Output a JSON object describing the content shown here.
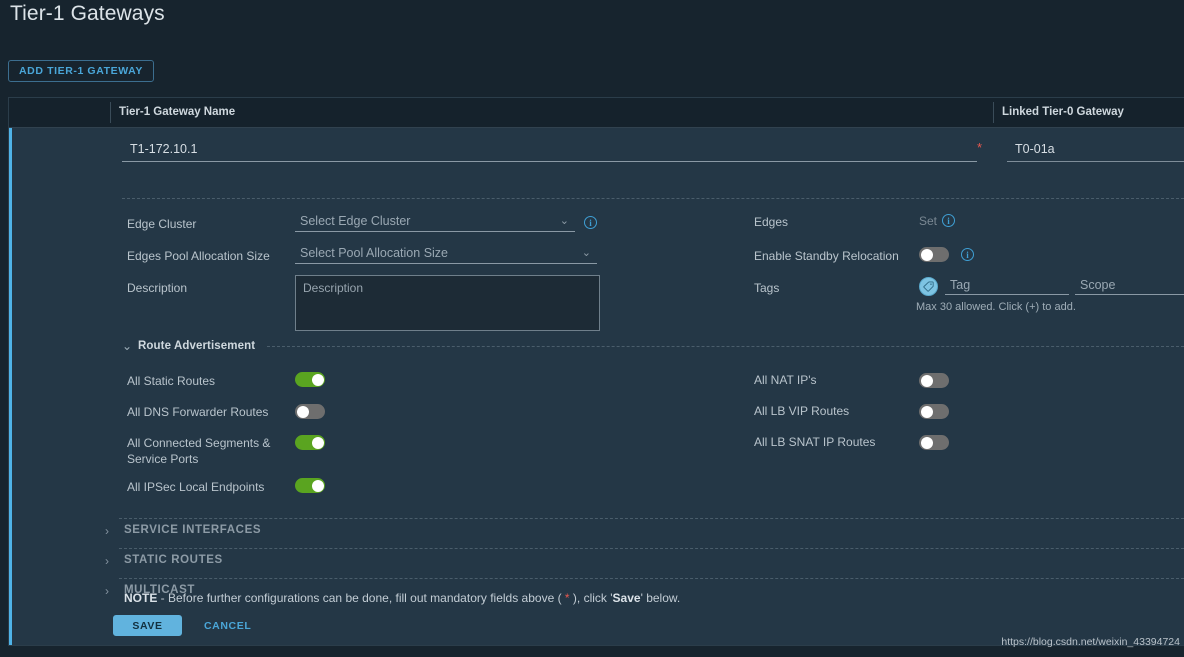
{
  "page": {
    "title": "Tier-1 Gateways",
    "add_button": "ADD TIER-1 GATEWAY",
    "watermark": "https://blog.csdn.net/weixin_43394724"
  },
  "grid": {
    "columns": [
      {
        "key": "name",
        "label": "Tier-1 Gateway Name"
      },
      {
        "key": "linked",
        "label": "Linked Tier-0 Gateway"
      }
    ]
  },
  "row": {
    "gateway_name_value": "T1-172.10.1",
    "gateway_name_required_marker": "*",
    "linked_tier0_value": "T0-01a"
  },
  "form": {
    "left": {
      "edge_cluster_label": "Edge Cluster",
      "edge_cluster_placeholder": "Select Edge Cluster",
      "pool_allocation_label": "Edges Pool Allocation Size",
      "pool_allocation_placeholder": "Select Pool Allocation Size",
      "description_label": "Description",
      "description_placeholder": "Description"
    },
    "right": {
      "edges_label": "Edges",
      "edges_set_link": "Set",
      "standby_relocation_label": "Enable Standby Relocation",
      "standby_relocation_state": "off",
      "tags_label": "Tags",
      "tag_placeholder": "Tag",
      "scope_placeholder": "Scope",
      "tags_hint": "Max 30 allowed. Click (+) to add."
    }
  },
  "route_advertisement": {
    "section_title": "Route Advertisement",
    "expanded": true,
    "left_toggles": [
      {
        "label": "All Static Routes",
        "state": "on"
      },
      {
        "label": "All DNS Forwarder Routes",
        "state": "off"
      },
      {
        "label": "All Connected Segments & Service Ports",
        "state": "on"
      },
      {
        "label": "All IPSec Local Endpoints",
        "state": "on"
      }
    ],
    "right_toggles": [
      {
        "label": "All NAT IP's",
        "state": "off"
      },
      {
        "label": "All LB VIP Routes",
        "state": "off"
      },
      {
        "label": "All LB SNAT IP Routes",
        "state": "off"
      }
    ]
  },
  "note": {
    "bold_prefix": "NOTE",
    "text_part1": " - Before further configurations can be done, fill out mandatory fields above ( ",
    "star": "*",
    "text_part2": " ), click '",
    "bold_save": "Save",
    "text_part3": "' below."
  },
  "collapsed_sections": [
    {
      "label": "SERVICE INTERFACES"
    },
    {
      "label": "STATIC ROUTES"
    },
    {
      "label": "MULTICAST"
    }
  ],
  "footer": {
    "save_label": "SAVE",
    "cancel_label": "CANCEL"
  },
  "colors": {
    "accent_blue": "#4fb3e8",
    "link_blue": "#4aa6d8",
    "toggle_on_green": "#5aa420",
    "toggle_off_gray": "#6e6e6e",
    "required_red": "#e8584f",
    "panel_bg": "#243746",
    "page_bg": "#17242e"
  },
  "icons": {
    "chevron_down": "⌄",
    "chevron_right": "›",
    "info": "i",
    "tag": "tag-icon"
  }
}
